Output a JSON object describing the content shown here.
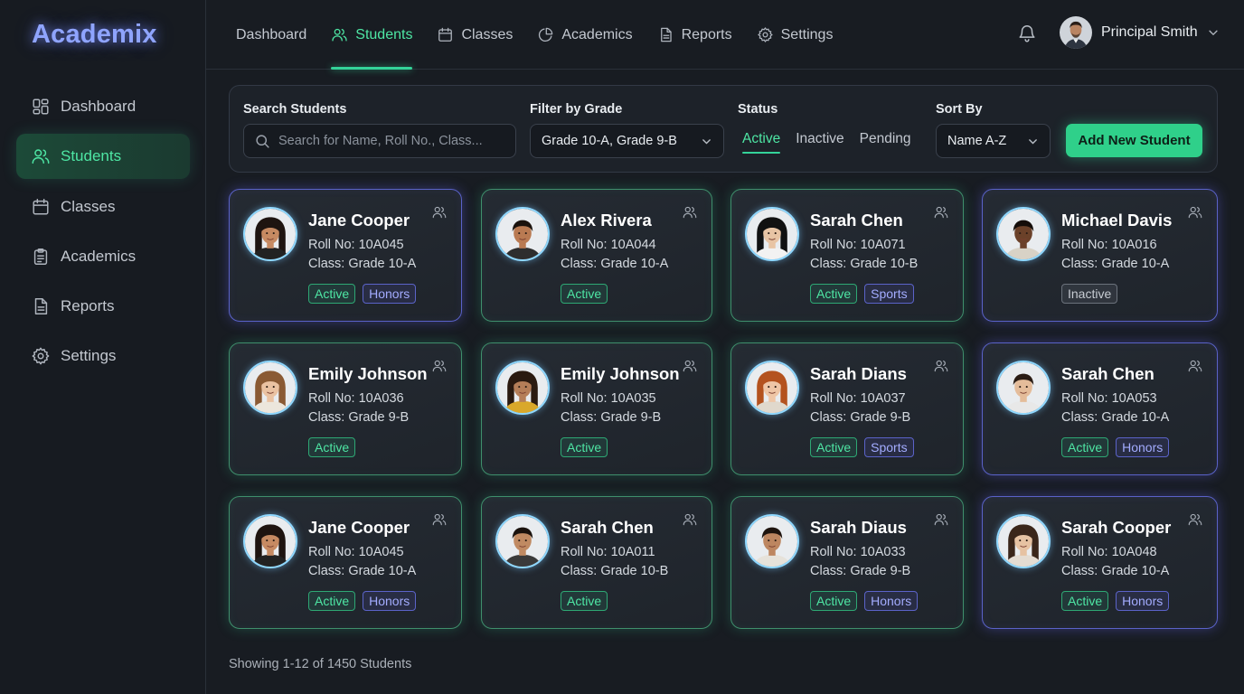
{
  "app": {
    "logo": "Academix"
  },
  "sidebar": {
    "items": [
      {
        "label": "Dashboard",
        "icon": "dashboard-icon",
        "active": false
      },
      {
        "label": "Students",
        "icon": "users-icon",
        "active": true
      },
      {
        "label": "Classes",
        "icon": "calendar-icon",
        "active": false
      },
      {
        "label": "Academics",
        "icon": "clipboard-icon",
        "active": false
      },
      {
        "label": "Reports",
        "icon": "document-icon",
        "active": false
      },
      {
        "label": "Settings",
        "icon": "gear-icon",
        "active": false
      }
    ]
  },
  "topnav": {
    "items": [
      {
        "label": "Dashboard",
        "icon": "",
        "active": false
      },
      {
        "label": "Students",
        "icon": "users-icon",
        "active": true
      },
      {
        "label": "Classes",
        "icon": "calendar-icon",
        "active": false
      },
      {
        "label": "Academics",
        "icon": "pie-chart-icon",
        "active": false
      },
      {
        "label": "Reports",
        "icon": "document-icon",
        "active": false
      },
      {
        "label": "Settings",
        "icon": "gear-icon",
        "active": false
      }
    ],
    "user_name": "Principal Smith"
  },
  "filters": {
    "search_label": "Search Students",
    "search_placeholder": "Search for Name, Roll No., Class...",
    "grade_label": "Filter by Grade",
    "grade_value": "Grade 10-A, Grade 9-B",
    "status_label": "Status",
    "status_tabs": [
      "Active",
      "Inactive",
      "Pending"
    ],
    "status_active": "Active",
    "sort_label": "Sort By",
    "sort_value": "Name A-Z",
    "add_button": "Add New Student"
  },
  "students": [
    {
      "name": "Jane Cooper",
      "roll": "Roll No: 10A045",
      "class": "Class: Grade 10-A",
      "tags": [
        {
          "t": "Active",
          "c": "green"
        },
        {
          "t": "Honors",
          "c": "blue"
        }
      ],
      "glow": "blue",
      "skin": "#c68a62",
      "hair": "#1e1410",
      "shirt": "#222222",
      "long": true
    },
    {
      "name": "Alex Rivera",
      "roll": "Roll No: 10A044",
      "class": "Class: Grade 10-A",
      "tags": [
        {
          "t": "Active",
          "c": "green"
        }
      ],
      "glow": "green",
      "skin": "#b97a52",
      "hair": "#1a120d",
      "shirt": "#2e2e2e",
      "long": false
    },
    {
      "name": "Sarah Chen",
      "roll": "Roll No: 10A071",
      "class": "Class: Grade 10-B",
      "tags": [
        {
          "t": "Active",
          "c": "green"
        },
        {
          "t": "Sports",
          "c": "blue"
        }
      ],
      "glow": "green",
      "skin": "#e8c4a4",
      "hair": "#111111",
      "shirt": "#f2f2f2",
      "long": true
    },
    {
      "name": "Michael Davis",
      "roll": "Roll No: 10A016",
      "class": "Class: Grade 10-A",
      "tags": [
        {
          "t": "Inactive",
          "c": "gray"
        }
      ],
      "glow": "blue",
      "skin": "#6b4129",
      "hair": "#140d09",
      "shirt": "#d8d2c6",
      "long": false
    },
    {
      "name": "Emily Johnson",
      "roll": "Roll No: 10A036",
      "class": "Class: Grade 9-B",
      "tags": [
        {
          "t": "Active",
          "c": "green"
        }
      ],
      "glow": "green",
      "skin": "#eac2a2",
      "hair": "#8a5a34",
      "shirt": "#ece6dc",
      "long": true
    },
    {
      "name": "Emily Johnson",
      "roll": "Roll No: 10A035",
      "class": "Class: Grade 9-B",
      "tags": [
        {
          "t": "Active",
          "c": "green"
        }
      ],
      "glow": "green",
      "skin": "#b57e58",
      "hair": "#2a1a10",
      "shirt": "#d9a82a",
      "long": true
    },
    {
      "name": "Sarah Dians",
      "roll": "Roll No: 10A037",
      "class": "Class: Grade 9-B",
      "tags": [
        {
          "t": "Active",
          "c": "green"
        },
        {
          "t": "Sports",
          "c": "blue"
        }
      ],
      "glow": "green",
      "skin": "#efc6a6",
      "hair": "#b4521e",
      "shirt": "#e0d8cc",
      "long": true
    },
    {
      "name": "Sarah Chen",
      "roll": "Roll No: 10A053",
      "class": "Class: Grade 10-A",
      "tags": [
        {
          "t": "Active",
          "c": "green"
        },
        {
          "t": "Honors",
          "c": "blue"
        }
      ],
      "glow": "blue",
      "skin": "#e4bc9a",
      "hair": "#2a1c14",
      "shirt": "#e8e8e8",
      "long": false
    },
    {
      "name": "Jane Cooper",
      "roll": "Roll No: 10A045",
      "class": "Class: Grade 10-A",
      "tags": [
        {
          "t": "Active",
          "c": "green"
        },
        {
          "t": "Honors",
          "c": "blue"
        }
      ],
      "glow": "green",
      "skin": "#c68a62",
      "hair": "#1e1410",
      "shirt": "#222222",
      "long": true
    },
    {
      "name": "Sarah Chen",
      "roll": "Roll No: 10A011",
      "class": "Class: Grade 10-B",
      "tags": [
        {
          "t": "Active",
          "c": "green"
        }
      ],
      "glow": "green",
      "skin": "#c08a62",
      "hair": "#1a120d",
      "shirt": "#3a3a3a",
      "long": false
    },
    {
      "name": "Sarah Diaus",
      "roll": "Roll No: 10A033",
      "class": "Class: Grade 9-B",
      "tags": [
        {
          "t": "Active",
          "c": "green"
        },
        {
          "t": "Honors",
          "c": "blue"
        }
      ],
      "glow": "green",
      "skin": "#bd8660",
      "hair": "#1e140e",
      "shirt": "#e6e2da",
      "long": false
    },
    {
      "name": "Sarah Cooper",
      "roll": "Roll No: 10A048",
      "class": "Class: Grade 10-A",
      "tags": [
        {
          "t": "Active",
          "c": "green"
        },
        {
          "t": "Honors",
          "c": "blue"
        }
      ],
      "glow": "blue",
      "skin": "#e6c2a2",
      "hair": "#3a261a",
      "shirt": "#e4dcd2",
      "long": true
    }
  ],
  "footer": {
    "showing": "Showing 1-12 of 1450 Students"
  },
  "colors": {
    "accent": "#34d399",
    "logo": "#8fa4ff",
    "honors": "#6366f1"
  }
}
